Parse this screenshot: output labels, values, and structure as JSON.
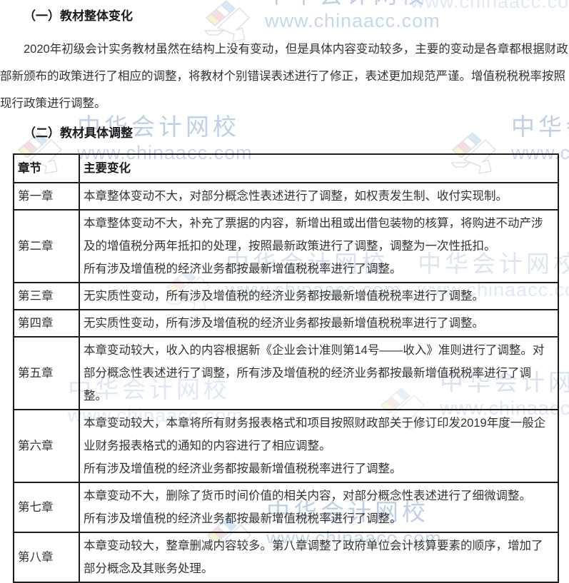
{
  "page": {
    "watermark": {
      "brand": "中华会计网校",
      "url": "www.chinaacc.com",
      "text_color": "#b4c7e4",
      "logo_colors": {
        "blue": "#cfe3f4",
        "pink": "#f9d5de",
        "yellow": "#f8f0c8",
        "outline": "#d8dde3"
      }
    },
    "section1": {
      "heading": "（一）教材整体变化",
      "paragraph": "2020年初级会计实务教材虽然在结构上没有变动，但是具体内容变动较多，主要的变动是各章都根据财政部新颁布的政策进行了相应的调整，将教材个别错误表述进行了修正，表述更加规范严谨。增值税税税率按照现行政策进行调整。"
    },
    "section2": {
      "heading": "（二）教材具体调整"
    },
    "table": {
      "headers": [
        "章节",
        "主要变化"
      ],
      "rows": [
        {
          "chapter": "第一章",
          "paragraphs": [
            "本章整体变动不大，对部分概念性表述进行了调整，如权责发生制、收付实现制。"
          ]
        },
        {
          "chapter": "第二章",
          "paragraphs": [
            "本章整体变动不大，补充了票据的内容，新增出租或出借包装物的核算，将购进不动产涉及的增值税分两年抵扣的处理，按照最新政策进行了调整，调整为一次性抵扣。",
            "所有涉及增值税的经济业务都按最新增值税税率进行了调整。"
          ]
        },
        {
          "chapter": "第三章",
          "paragraphs": [
            "无实质性变动，所有涉及增值税的经济业务都按最新增值税税率进行了调整。"
          ]
        },
        {
          "chapter": "第四章",
          "paragraphs": [
            "无实质性变动，所有涉及增值税的经济业务都按最新增值税税率进行了调整。"
          ]
        },
        {
          "chapter": "第五章",
          "paragraphs": [
            "本章变动较大，收入的内容根据新《企业会计准则第14号——收入》准则进行了调整。对部分概念性表述进行了调整，所有涉及增值税的经济业务都按最新增值税税率进行了调整。"
          ]
        },
        {
          "chapter": "第六章",
          "paragraphs": [
            "本章变动较大，本章将所有财务报表格式和项目按照财政部关于修订印发2019年度一般企业财务报表格式的通知的内容进行了相应调整。",
            "所有涉及增值税的经济业务都按最新增值税税率进行了调整。"
          ]
        },
        {
          "chapter": "第七章",
          "paragraphs": [
            "本章变动不大，删除了货币时间价值的相关内容，对部分概念性表述进行了细微调整。",
            "所有涉及增值税的经济业务都按最新增值税税率进行了调整。"
          ]
        },
        {
          "chapter": "第八章",
          "paragraphs": [
            "本章变动较大，整章删减内容较多。第八章调整了政府单位会计核算要素的顺序，增加了部分概念及其账务处理。"
          ]
        }
      ]
    }
  }
}
